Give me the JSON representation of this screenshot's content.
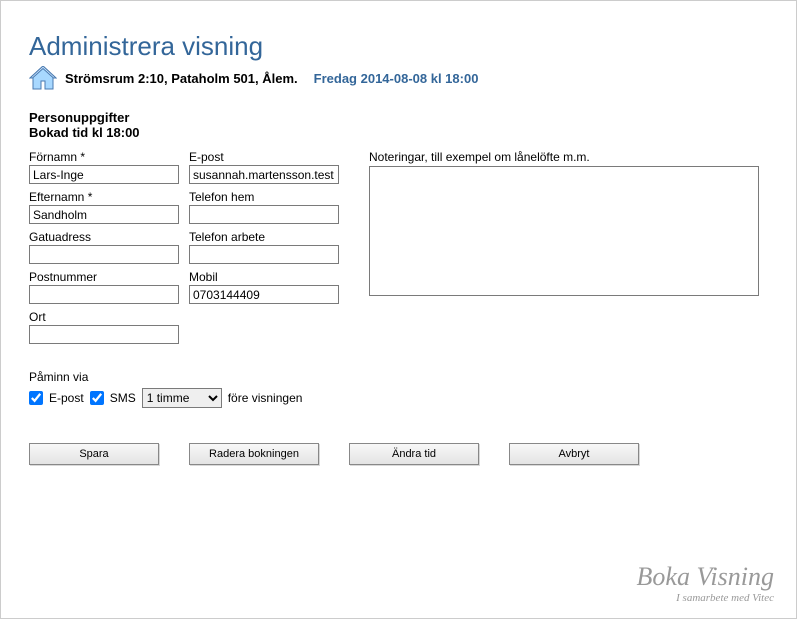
{
  "header": {
    "title": "Administrera visning",
    "address": "Strömsrum 2:10, Pataholm 501, Ålem.",
    "datetime": "Fredag 2014-08-08 kl 18:00"
  },
  "section": {
    "person_heading": "Personuppgifter",
    "booked_time": "Bokad tid kl 18:00"
  },
  "fields": {
    "fornamn_label": "Förnamn *",
    "fornamn_value": "Lars-Inge",
    "efternamn_label": "Efternamn *",
    "efternamn_value": "Sandholm",
    "gatuadress_label": "Gatuadress",
    "gatuadress_value": "",
    "postnummer_label": "Postnummer",
    "postnummer_value": "",
    "ort_label": "Ort",
    "ort_value": "",
    "epost_label": "E-post",
    "epost_value": "susannah.martensson.test",
    "telefon_hem_label": "Telefon hem",
    "telefon_hem_value": "",
    "telefon_arbete_label": "Telefon arbete",
    "telefon_arbete_value": "",
    "mobil_label": "Mobil",
    "mobil_value": "0703144409"
  },
  "notes": {
    "label": "Noteringar, till exempel om lånelöfte m.m.",
    "value": ""
  },
  "reminder": {
    "heading": "Påminn via",
    "epost_label": "E-post",
    "epost_checked": true,
    "sms_label": "SMS",
    "sms_checked": true,
    "interval_selected": "1 timme",
    "suffix": "före visningen"
  },
  "buttons": {
    "save": "Spara",
    "delete": "Radera bokningen",
    "change_time": "Ändra tid",
    "cancel": "Avbryt"
  },
  "footer": {
    "brand": "Boka Visning",
    "sub": "I samarbete med Vitec"
  }
}
